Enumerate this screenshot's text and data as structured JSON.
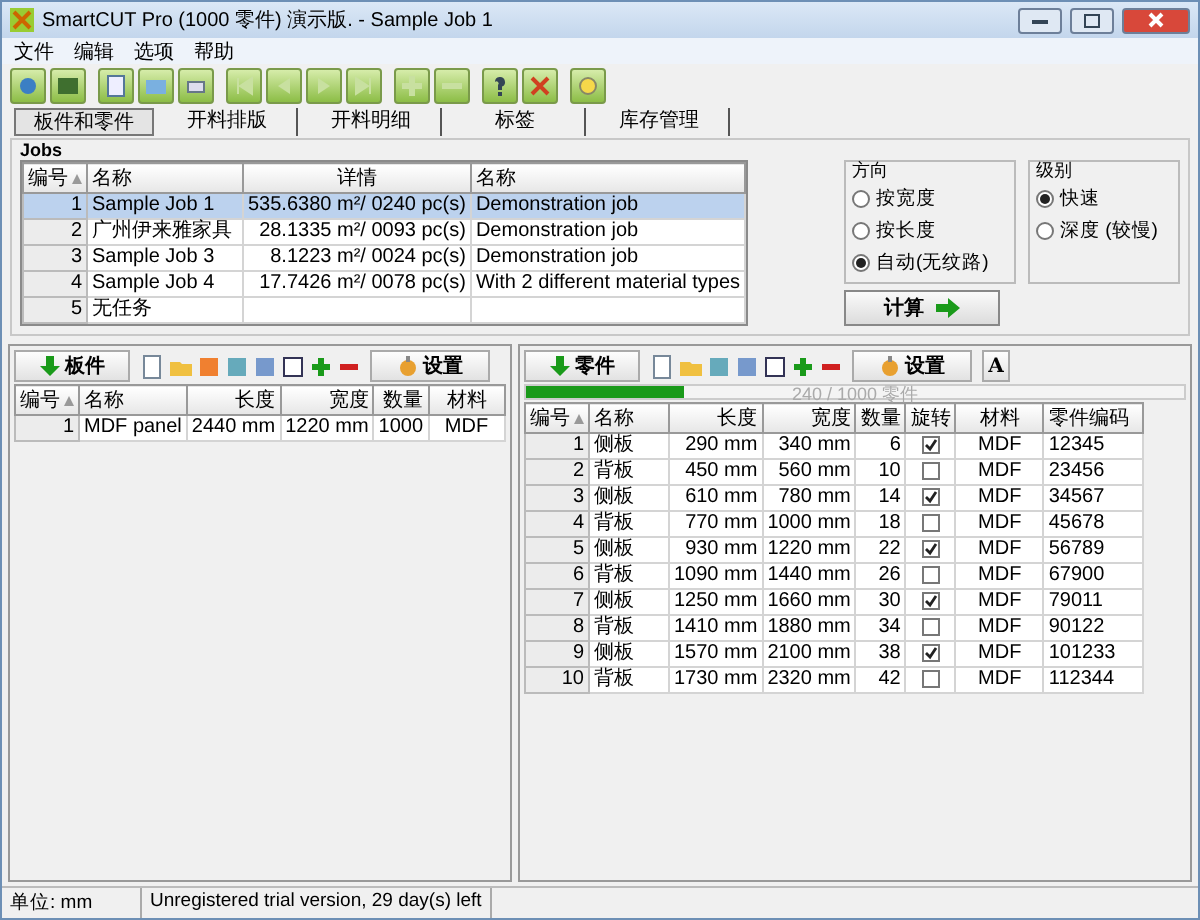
{
  "window": {
    "title": "SmartCUT Pro (1000 零件) 演示版. - Sample Job 1"
  },
  "menu": [
    "文件",
    "编辑",
    "选项",
    "帮助"
  ],
  "tabs": [
    {
      "label": "板件和零件",
      "selected": true
    },
    {
      "label": "开料排版",
      "selected": false
    },
    {
      "label": "开料明细",
      "selected": false
    },
    {
      "label": "标签",
      "selected": false
    },
    {
      "label": "库存管理",
      "selected": false
    }
  ],
  "jobs": {
    "title": "Jobs",
    "columns": [
      "编号",
      "名称",
      "详情",
      "名称"
    ],
    "rows": [
      {
        "no": "1",
        "name": "Sample Job 1",
        "detail": "535.6380 m²/ 0240 pc(s)",
        "desc": "Demonstration job",
        "selected": true
      },
      {
        "no": "2",
        "name": "广州伊来雅家具",
        "detail": "28.1335 m²/ 0093 pc(s)",
        "desc": "Demonstration job",
        "selected": false
      },
      {
        "no": "3",
        "name": "Sample Job 3",
        "detail": "8.1223 m²/ 0024 pc(s)",
        "desc": "Demonstration job",
        "selected": false
      },
      {
        "no": "4",
        "name": "Sample Job 4",
        "detail": "17.7426 m²/ 0078 pc(s)",
        "desc": "With 2 different material types",
        "selected": false
      },
      {
        "no": "5",
        "name": "无任务",
        "detail": "",
        "desc": "",
        "selected": false
      }
    ]
  },
  "direction": {
    "title": "方向",
    "options": [
      {
        "label": "按宽度",
        "selected": false
      },
      {
        "label": "按长度",
        "selected": false
      },
      {
        "label": "自动(无纹路)",
        "selected": true
      }
    ]
  },
  "level_group": {
    "title": "级别",
    "options": [
      {
        "label": "快速",
        "selected": true
      },
      {
        "label": "深度 (较慢)",
        "selected": false
      }
    ]
  },
  "calculate_button": "计算",
  "boards": {
    "button": "板件",
    "settings": "设置",
    "columns": [
      "编号",
      "名称",
      "长度",
      "宽度",
      "数量",
      "材料"
    ],
    "rows": [
      [
        "1",
        "MDF panel",
        "2440 mm",
        "1220 mm",
        "1000",
        "MDF"
      ]
    ]
  },
  "parts": {
    "button": "零件",
    "settings": "设置",
    "font_button": "A",
    "progress": {
      "level": 0.24,
      "text": "240 / 1000 零件"
    },
    "columns": [
      "编号",
      "名称",
      "长度",
      "宽度",
      "数量",
      "旋转",
      "材料",
      "零件编码"
    ],
    "rows": [
      {
        "no": "1",
        "name": "侧板",
        "length": "290 mm",
        "width": "340 mm",
        "qty": "6",
        "rotate": true,
        "material": "MDF",
        "code": "12345"
      },
      {
        "no": "2",
        "name": "背板",
        "length": "450 mm",
        "width": "560 mm",
        "qty": "10",
        "rotate": false,
        "material": "MDF",
        "code": "23456"
      },
      {
        "no": "3",
        "name": "侧板",
        "length": "610 mm",
        "width": "780 mm",
        "qty": "14",
        "rotate": true,
        "material": "MDF",
        "code": "34567"
      },
      {
        "no": "4",
        "name": "背板",
        "length": "770 mm",
        "width": "1000 mm",
        "qty": "18",
        "rotate": false,
        "material": "MDF",
        "code": "45678"
      },
      {
        "no": "5",
        "name": "侧板",
        "length": "930 mm",
        "width": "1220 mm",
        "qty": "22",
        "rotate": true,
        "material": "MDF",
        "code": "56789"
      },
      {
        "no": "6",
        "name": "背板",
        "length": "1090 mm",
        "width": "1440 mm",
        "qty": "26",
        "rotate": false,
        "material": "MDF",
        "code": "67900"
      },
      {
        "no": "7",
        "name": "侧板",
        "length": "1250 mm",
        "width": "1660 mm",
        "qty": "30",
        "rotate": true,
        "material": "MDF",
        "code": "79011"
      },
      {
        "no": "8",
        "name": "背板",
        "length": "1410 mm",
        "width": "1880 mm",
        "qty": "34",
        "rotate": false,
        "material": "MDF",
        "code": "90122"
      },
      {
        "no": "9",
        "name": "侧板",
        "length": "1570 mm",
        "width": "2100 mm",
        "qty": "38",
        "rotate": true,
        "material": "MDF",
        "code": "101233"
      },
      {
        "no": "10",
        "name": "背板",
        "length": "1730 mm",
        "width": "2320 mm",
        "qty": "42",
        "rotate": false,
        "material": "MDF",
        "code": "112344"
      }
    ]
  },
  "status_bar": [
    "单位: mm",
    "Unregistered trial version, 29 day(s) left"
  ]
}
